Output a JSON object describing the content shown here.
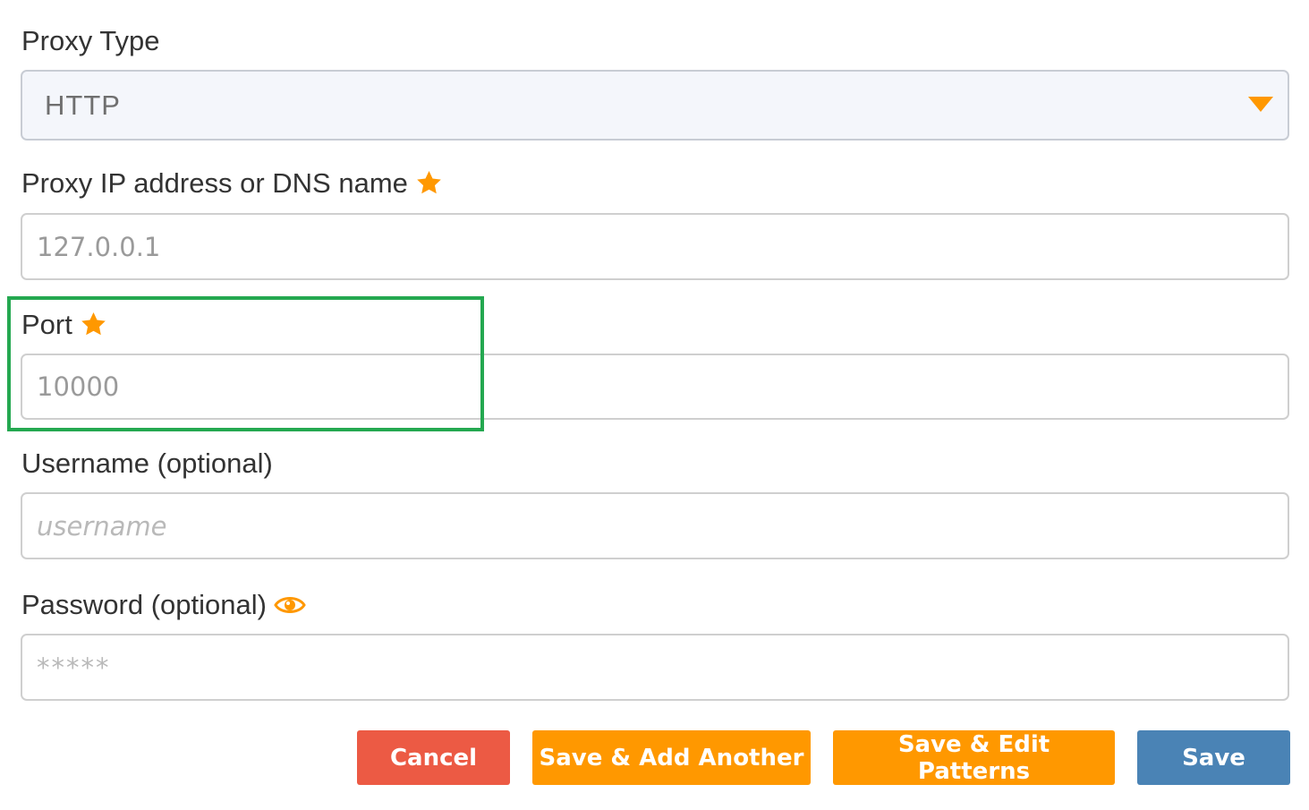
{
  "form": {
    "proxy_type": {
      "label": "Proxy Type",
      "selected": "HTTP"
    },
    "proxy_ip": {
      "label": "Proxy IP address or DNS name",
      "value": "127.0.0.1",
      "required_icon": "star-icon"
    },
    "port": {
      "label": "Port",
      "value": "10000",
      "required_icon": "star-icon"
    },
    "username": {
      "label": "Username (optional)",
      "placeholder": "username"
    },
    "password": {
      "label": "Password (optional)",
      "placeholder": "*****",
      "toggle_icon": "eye-icon"
    }
  },
  "buttons": {
    "cancel": "Cancel",
    "save_add_another": "Save & Add Another",
    "save_edit_patterns": "Save & Edit Patterns",
    "save": "Save"
  },
  "colors": {
    "accent_orange": "#ff9800",
    "cancel_red": "#ec5a44",
    "save_blue": "#4a83b5",
    "highlight_green": "#24a850"
  }
}
